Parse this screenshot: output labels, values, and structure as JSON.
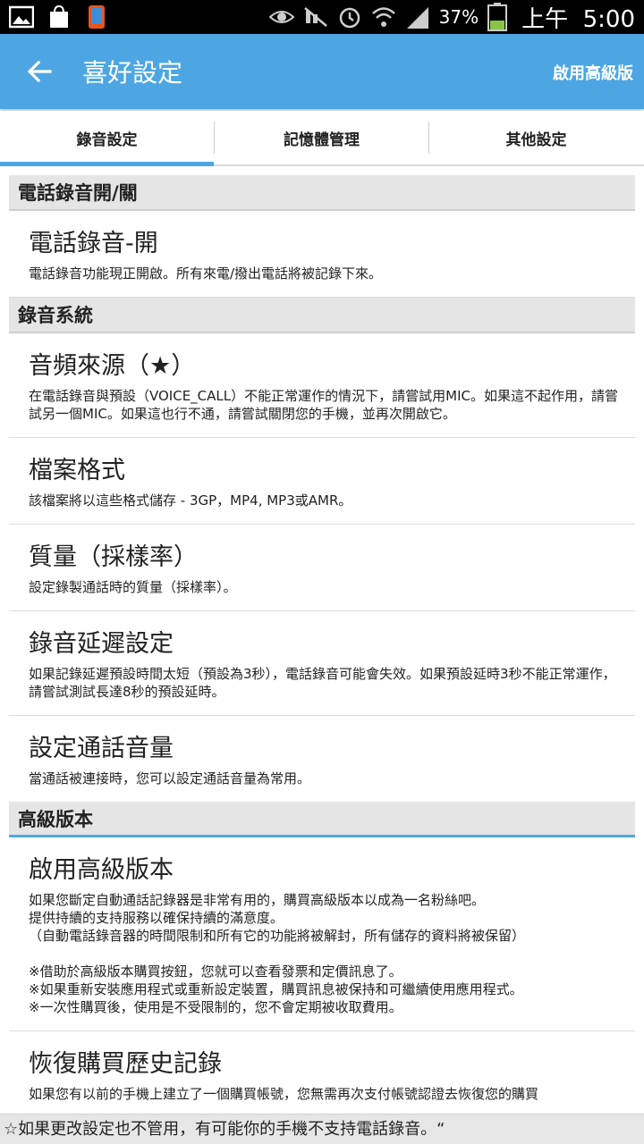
{
  "status_bar": {
    "icons_left": [
      "gallery-icon",
      "galaxy-bag-icon",
      "phone-app-icon"
    ],
    "icons_right": [
      "eye-icon",
      "mute-icon",
      "alarm-icon",
      "wifi-icon",
      "signal-icon"
    ],
    "battery_percent": "37%",
    "battery_level": 0.37,
    "time": "上午  5:00"
  },
  "appbar": {
    "title": "喜好設定",
    "action": "啟用高級版"
  },
  "tabs": [
    {
      "label": "錄音設定",
      "selected": true
    },
    {
      "label": "記憶體管理",
      "selected": false
    },
    {
      "label": "其他設定",
      "selected": false
    }
  ],
  "sections": {
    "s1": "電話錄音開/關",
    "s2": "錄音系統",
    "s3": "高級版本"
  },
  "items": {
    "call_record": {
      "title": "電話錄音-開",
      "desc": "電話錄音功能現正開啟。所有來電/撥出電話將被記錄下來。"
    },
    "audio_source": {
      "title": "音頻來源（★）",
      "desc": "在電話錄音與預設（VOICE_CALL）不能正常運作的情況下，請嘗試用MIC。如果這不起作用，請嘗試另一個MIC。如果這也行不通，請嘗試關閉您的手機，並再次開啟它。"
    },
    "file_format": {
      "title": "檔案格式",
      "desc": "該檔案將以這些格式儲存 - 3GP，MP4, MP3或AMR。"
    },
    "quality": {
      "title": "質量（採樣率）",
      "desc": "設定錄製通話時的質量（採樣率）。"
    },
    "delay": {
      "title": "錄音延遲設定",
      "desc": "如果記錄延遲預設時間太短（預設為3秒），電話錄音可能會失效。如果預設延時3秒不能正常運作，請嘗試測試長達8秒的預設延時。"
    },
    "volume": {
      "title": "設定通話音量",
      "desc": "當通話被連接時，您可以設定通話音量為常用。"
    },
    "premium": {
      "title": "啟用高級版本",
      "desc": "如果您斷定自動通話記錄器是非常有用的，購買高級版本以成為一名粉絲吧。\n提供持續的支持服務以確保持續的滿意度。\n（自動電話錄音器的時間限制和所有它的功能將被解封，所有儲存的資料將被保留）\n\n※借助於高級版本購買按鈕，您就可以查看發票和定價訊息了。\n※如果重新安裝應用程式或重新設定裝置，購買訊息被保持和可繼續使用應用程式。\n※一次性購買後，使用是不受限制的，您不會定期被收取費用。"
    },
    "restore": {
      "title": "恢復購買歷史記錄",
      "desc": "如果您有以前的手機上建立了一個購買帳號，您無需再次支付帳號認證去恢復您的購買"
    }
  },
  "bottom_note": "☆如果更改設定也不管用，有可能你的手機不支持電話錄音。“",
  "colors": {
    "accent": "#4da6e3",
    "section_bg": "#e5e5e5",
    "status_bar": "#000000"
  }
}
